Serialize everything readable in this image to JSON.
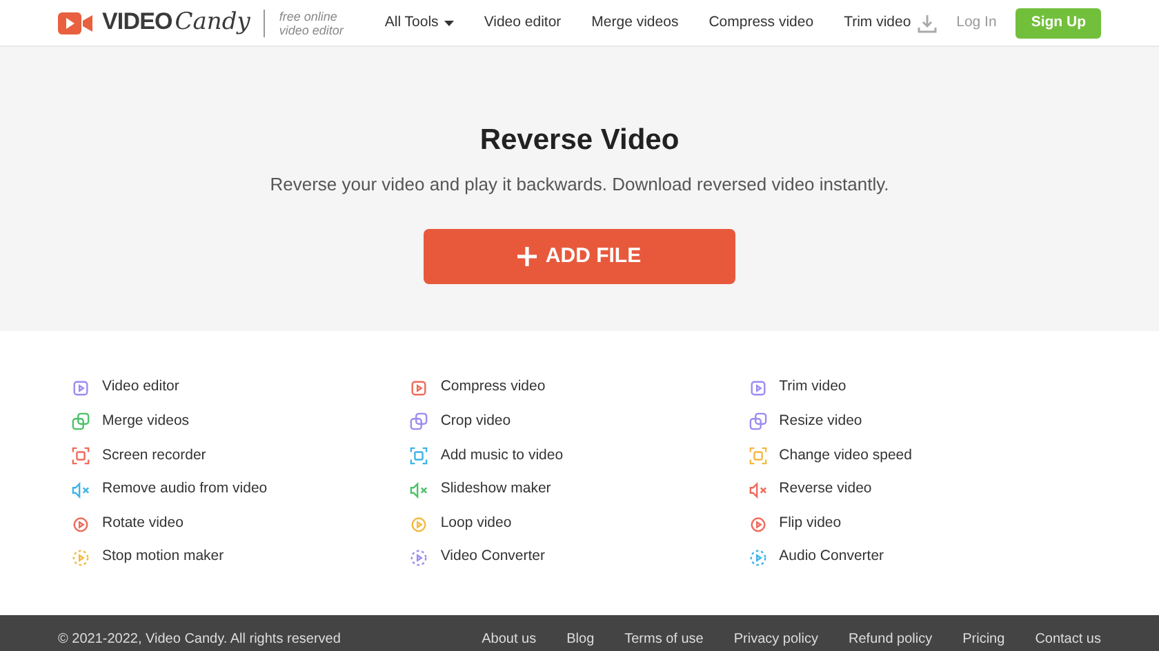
{
  "header": {
    "logo": {
      "word_1": "VIDEO",
      "word_2": "Candy",
      "tagline_1": "free online",
      "tagline_2": "video editor"
    },
    "nav": [
      {
        "label": "All Tools",
        "dropdown": true
      },
      {
        "label": "Video editor",
        "dropdown": false
      },
      {
        "label": "Merge videos",
        "dropdown": false
      },
      {
        "label": "Compress video",
        "dropdown": false
      },
      {
        "label": "Trim video",
        "dropdown": false
      }
    ],
    "login": "Log In",
    "signup": "Sign Up"
  },
  "hero": {
    "title": "Reverse Video",
    "subtitle": "Reverse your video and play it backwards. Download reversed video instantly.",
    "button": "ADD FILE"
  },
  "tools": [
    [
      {
        "label": "Video editor",
        "color": "#9b8cf0"
      },
      {
        "label": "Merge videos",
        "color": "#4cc26a"
      },
      {
        "label": "Screen recorder",
        "color": "#ef6b5b"
      },
      {
        "label": "Remove audio from video",
        "color": "#3fb3e8"
      },
      {
        "label": "Rotate video",
        "color": "#ef6b5b"
      },
      {
        "label": "Stop motion maker",
        "color": "#f5b942"
      }
    ],
    [
      {
        "label": "Compress video",
        "color": "#ef6b5b"
      },
      {
        "label": "Crop video",
        "color": "#9b8cf0"
      },
      {
        "label": "Add music to video",
        "color": "#3fb3e8"
      },
      {
        "label": "Slideshow maker",
        "color": "#4cc26a"
      },
      {
        "label": "Loop video",
        "color": "#f5b942"
      },
      {
        "label": "Video Converter",
        "color": "#9b8cf0"
      }
    ],
    [
      {
        "label": "Trim video",
        "color": "#9b8cf0"
      },
      {
        "label": "Resize video",
        "color": "#9b8cf0"
      },
      {
        "label": "Change video speed",
        "color": "#f5b942"
      },
      {
        "label": "Reverse video",
        "color": "#ef6b5b"
      },
      {
        "label": "Flip video",
        "color": "#ef6b5b"
      },
      {
        "label": "Audio Converter",
        "color": "#3fb3e8"
      }
    ]
  ],
  "footer": {
    "copyright": "© 2021-2022, Video Candy. All rights reserved",
    "links": [
      "About us",
      "Blog",
      "Terms of use",
      "Privacy policy",
      "Refund policy",
      "Pricing",
      "Contact us"
    ]
  }
}
